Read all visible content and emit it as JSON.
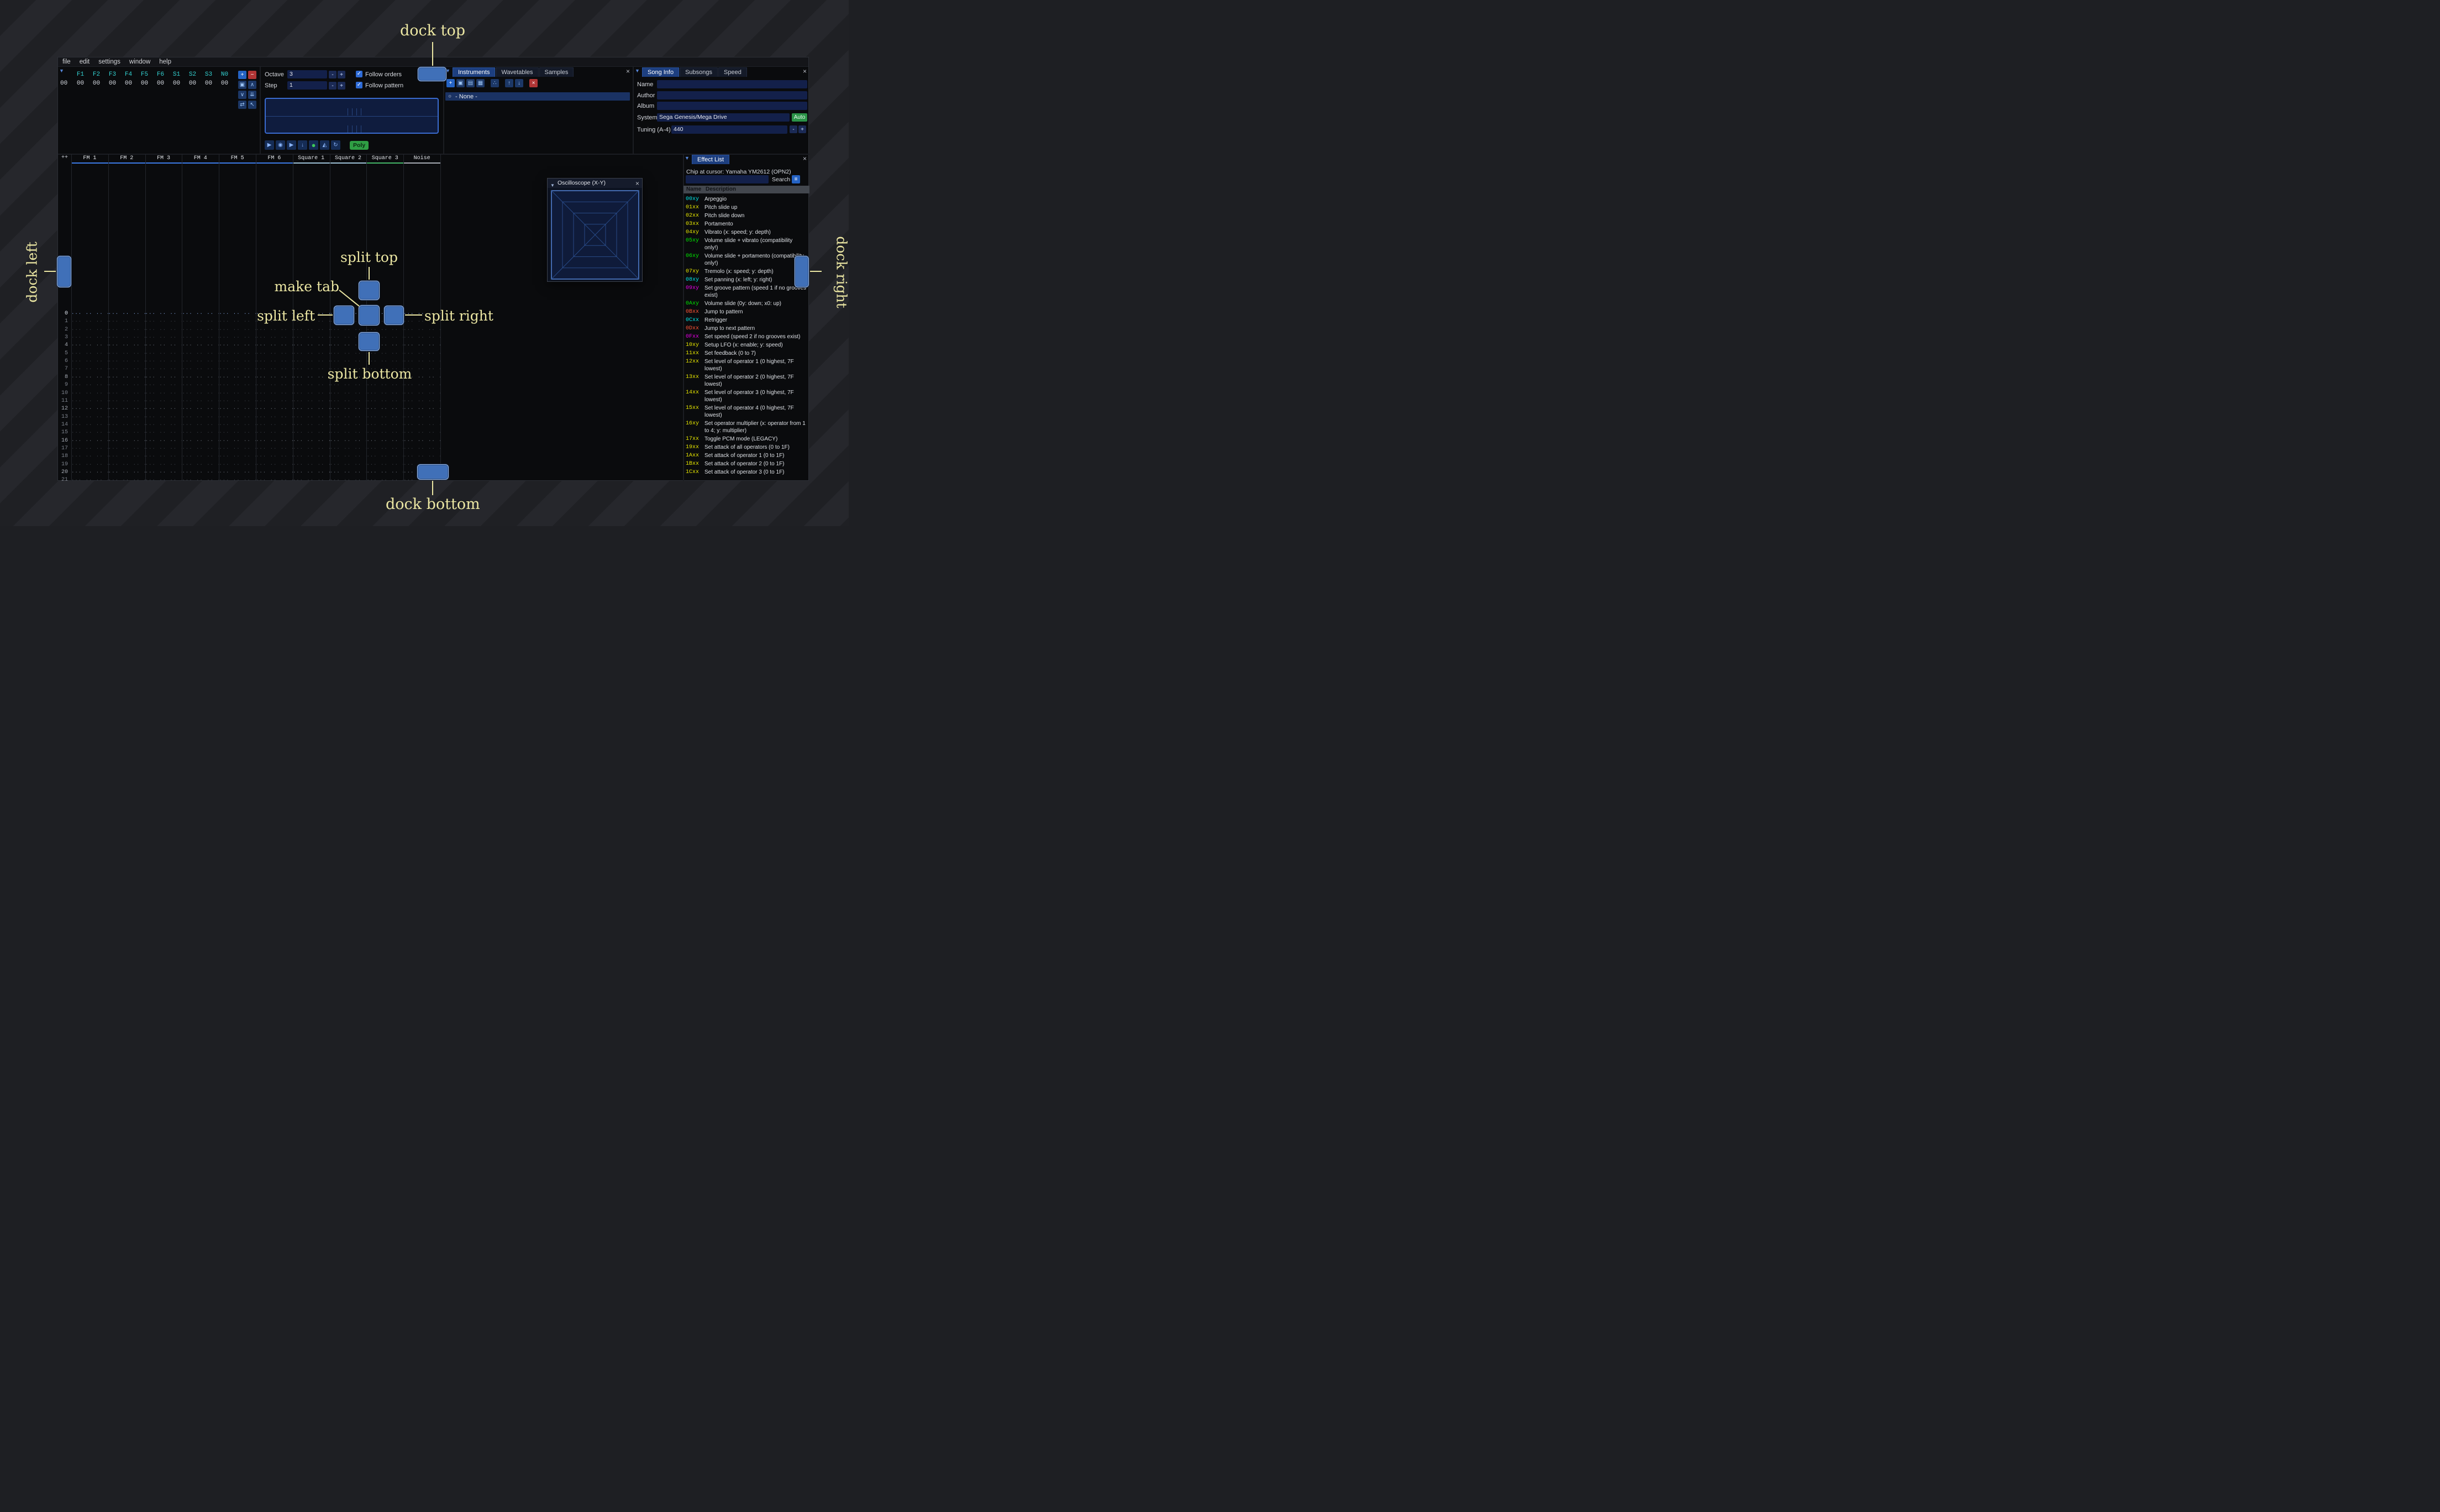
{
  "colors": {
    "accent_blue": "#4070b8",
    "annotation_yellow": "#ece7a3",
    "green": "#2b9348",
    "red": "#b03535",
    "cyan": "#33d2d2"
  },
  "menu": {
    "items": [
      "file",
      "edit",
      "settings",
      "window",
      "help"
    ]
  },
  "orders": {
    "collapse_icon": "▼",
    "channels": [
      "F1",
      "F2",
      "F3",
      "F4",
      "F5",
      "F6",
      "S1",
      "S2",
      "S3",
      "N0"
    ],
    "row_index": "00",
    "row_values": [
      "00",
      "00",
      "00",
      "00",
      "00",
      "00",
      "00",
      "00",
      "00",
      "00"
    ],
    "buttons": [
      {
        "name": "add-order-button",
        "glyph": "+",
        "style": "blue"
      },
      {
        "name": "remove-order-button",
        "glyph": "−",
        "style": "red"
      },
      {
        "name": "duplicate-order-button",
        "glyph": "▣",
        "style": ""
      },
      {
        "name": "move-order-up-button",
        "glyph": "∧",
        "style": ""
      },
      {
        "name": "move-order-down-button",
        "glyph": "∨",
        "style": ""
      },
      {
        "name": "duplicate-order-to-end-button",
        "glyph": "⇊",
        "style": ""
      },
      {
        "name": "change-all-orders-button",
        "glyph": "⇄",
        "style": ""
      },
      {
        "name": "order-edit-mode-button",
        "glyph": "↖",
        "style": ""
      }
    ]
  },
  "controls": {
    "octave_label": "Octave",
    "octave_value": "3",
    "step_label": "Step",
    "step_value": "1",
    "minus": "-",
    "plus": "+",
    "check_glyph": "✓",
    "follow_orders": "Follow orders",
    "follow_pattern": "Follow pattern",
    "transport": [
      {
        "name": "play-button",
        "glyph": "▶",
        "style": ""
      },
      {
        "name": "play-pattern-button",
        "glyph": "◉",
        "style": ""
      },
      {
        "name": "play-once-button",
        "glyph": "▶",
        "style": ""
      },
      {
        "name": "play-from-cursor-button",
        "glyph": "↓",
        "style": ""
      },
      {
        "name": "record-button",
        "glyph": "●",
        "style": "record"
      },
      {
        "name": "metronome-button",
        "glyph": "◭",
        "style": ""
      },
      {
        "name": "repeat-pattern-button",
        "glyph": "↻",
        "style": ""
      }
    ],
    "poly_label": "Poly"
  },
  "instruments": {
    "collapse_icon": "▼",
    "tabs": [
      "Instruments",
      "Wavetables",
      "Samples"
    ],
    "active_tab": 0,
    "close_glyph": "×",
    "toolbar": [
      {
        "name": "add-instrument-button",
        "glyph": "+",
        "style": "blue"
      },
      {
        "name": "clone-instrument-button",
        "glyph": "▣",
        "style": ""
      },
      {
        "name": "open-instrument-button",
        "glyph": "▤",
        "style": ""
      },
      {
        "name": "save-instrument-button",
        "glyph": "▦",
        "style": ""
      },
      {
        "name": "instrument-folders-button",
        "glyph": "∴",
        "style": ""
      },
      {
        "name": "move-instrument-up-button",
        "glyph": "↑",
        "style": ""
      },
      {
        "name": "move-instrument-down-button",
        "glyph": "↓",
        "style": ""
      },
      {
        "name": "delete-instrument-button",
        "glyph": "×",
        "style": "red"
      }
    ],
    "radio_glyph": "○",
    "selected_item": "- None -"
  },
  "song_info": {
    "collapse_icon": "▼",
    "tabs": [
      "Song Info",
      "Subsongs",
      "Speed"
    ],
    "active_tab": 0,
    "close_glyph": "×",
    "name_label": "Name",
    "name_value": "",
    "author_label": "Author",
    "author_value": "",
    "album_label": "Album",
    "album_value": "",
    "system_label": "System",
    "system_value": "Sega Genesis/Mega Drive",
    "auto_label": "Auto",
    "tuning_label": "Tuning (A-4)",
    "tuning_value": "440",
    "minus": "-",
    "plus": "+"
  },
  "pattern": {
    "corner_label": "++",
    "channels": [
      {
        "name": "FM 1",
        "color": "#3d7be8"
      },
      {
        "name": "FM 2",
        "color": "#3d7be8"
      },
      {
        "name": "FM 3",
        "color": "#3d7be8"
      },
      {
        "name": "FM 4",
        "color": "#3d7be8"
      },
      {
        "name": "FM 5",
        "color": "#3d7be8"
      },
      {
        "name": "FM 6",
        "color": "#3d7be8"
      },
      {
        "name": "Square 1",
        "color": "#9fc3d8"
      },
      {
        "name": "Square 2",
        "color": "#9fc3d8"
      },
      {
        "name": "Square 3",
        "color": "#45b868"
      },
      {
        "name": "Noise",
        "color": "#a8adb5"
      }
    ],
    "row_count": 22,
    "cursor_row": 0,
    "highlight_every": 4,
    "empty_cell": "··· ·· ·· ···"
  },
  "oscilloscope": {
    "collapse_icon": "▼",
    "title": "Oscilloscope (X-Y)",
    "close_glyph": "×"
  },
  "effect_list": {
    "collapse_icon": "▼",
    "tab": "Effect List",
    "close_glyph": "×",
    "chip_line": "Chip at cursor: Yamaha YM2612 (OPN2)",
    "search_value": "",
    "search_label": "Search",
    "menu_icon": "≡",
    "name_column": "Name",
    "description_column": "Description",
    "effects": [
      {
        "code": "00xy",
        "color": "#00e5e5",
        "desc": "Arpeggio"
      },
      {
        "code": "01xx",
        "color": "#e5e500",
        "desc": "Pitch slide up"
      },
      {
        "code": "02xx",
        "color": "#e5e500",
        "desc": "Pitch slide down"
      },
      {
        "code": "03xx",
        "color": "#e5e500",
        "desc": "Portamento"
      },
      {
        "code": "04xy",
        "color": "#e5e500",
        "desc": "Vibrato (x: speed; y: depth)"
      },
      {
        "code": "05xy",
        "color": "#00e500",
        "desc": "Volume slide + vibrato (compatibility only!)"
      },
      {
        "code": "06xy",
        "color": "#00e500",
        "desc": "Volume slide + portamento (compatibility only!)"
      },
      {
        "code": "07xy",
        "color": "#e5e500",
        "desc": "Tremolo (x: speed; y: depth)"
      },
      {
        "code": "08xy",
        "color": "#00e5e5",
        "desc": "Set panning (x: left; y: right)"
      },
      {
        "code": "09xy",
        "color": "#e500e5",
        "desc": "Set groove pattern (speed 1 if no grooves exist)"
      },
      {
        "code": "0Axy",
        "color": "#00e500",
        "desc": "Volume slide (0y: down; x0: up)"
      },
      {
        "code": "0Bxx",
        "color": "#ff5436",
        "desc": "Jump to pattern"
      },
      {
        "code": "0Cxx",
        "color": "#00e5e5",
        "desc": "Retrigger"
      },
      {
        "code": "0Dxx",
        "color": "#ff5436",
        "desc": "Jump to next pattern"
      },
      {
        "code": "0Fxx",
        "color": "#e500e5",
        "desc": "Set speed (speed 2 if no grooves exist)"
      },
      {
        "code": "10xy",
        "color": "#e5e500",
        "desc": "Setup LFO (x: enable; y: speed)"
      },
      {
        "code": "11xx",
        "color": "#e5e500",
        "desc": "Set feedback (0 to 7)"
      },
      {
        "code": "12xx",
        "color": "#e5e500",
        "desc": "Set level of operator 1 (0 highest, 7F lowest)"
      },
      {
        "code": "13xx",
        "color": "#e5e500",
        "desc": "Set level of operator 2 (0 highest, 7F lowest)"
      },
      {
        "code": "14xx",
        "color": "#e5e500",
        "desc": "Set level of operator 3 (0 highest, 7F lowest)"
      },
      {
        "code": "15xx",
        "color": "#e5e500",
        "desc": "Set level of operator 4 (0 highest, 7F lowest)"
      },
      {
        "code": "16xy",
        "color": "#e5e500",
        "desc": "Set operator multiplier (x: operator from 1 to 4; y: multiplier)"
      },
      {
        "code": "17xx",
        "color": "#e5e500",
        "desc": "Toggle PCM mode (LEGACY)"
      },
      {
        "code": "19xx",
        "color": "#e5e500",
        "desc": "Set attack of all operators (0 to 1F)"
      },
      {
        "code": "1Axx",
        "color": "#e5e500",
        "desc": "Set attack of operator 1 (0 to 1F)"
      },
      {
        "code": "1Bxx",
        "color": "#e5e500",
        "desc": "Set attack of operator 2 (0 to 1F)"
      },
      {
        "code": "1Cxx",
        "color": "#e5e500",
        "desc": "Set attack of operator 3 (0 to 1F)"
      }
    ]
  },
  "annotations": {
    "dock_top": "dock top",
    "dock_left": "dock left",
    "dock_right": "dock right",
    "dock_bottom": "dock bottom",
    "split_top": "split top",
    "split_left": "split left",
    "split_right": "split right",
    "split_bottom": "split bottom",
    "make_tab": "make tab"
  }
}
